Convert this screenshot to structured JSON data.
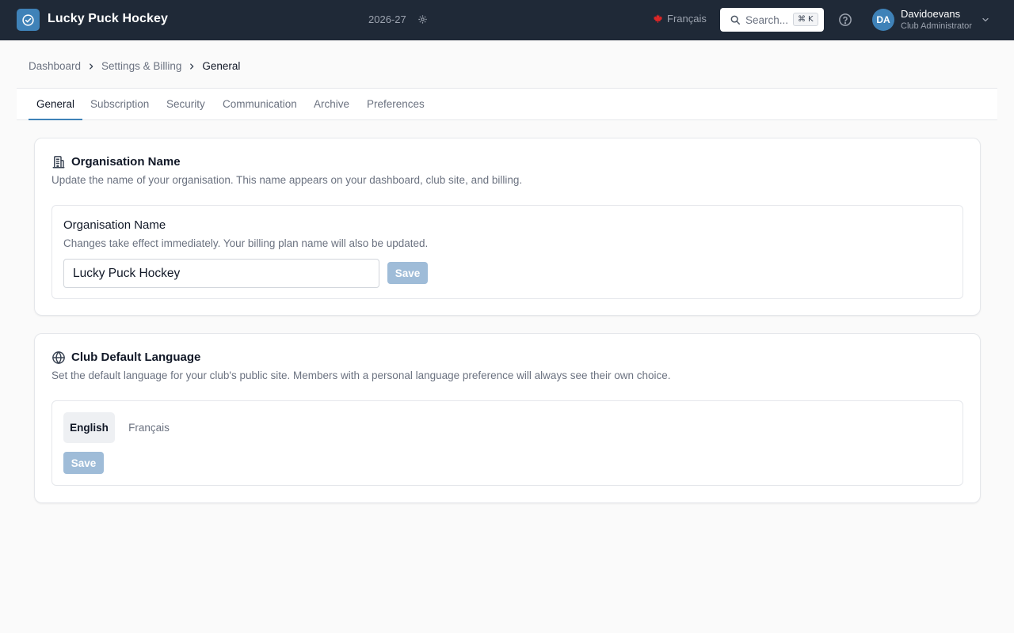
{
  "header": {
    "app_title": "Lucky Puck Hockey",
    "season": "2026-27",
    "language_link": "Français",
    "search_placeholder": "Search...",
    "search_shortcut_key": "K",
    "user": {
      "initials": "DA",
      "name": "Davidoevans",
      "role": "Club Administrator"
    }
  },
  "breadcrumb": {
    "items": [
      "Dashboard",
      "Settings & Billing"
    ],
    "current": "General"
  },
  "tabs": [
    "General",
    "Subscription",
    "Security",
    "Communication",
    "Archive",
    "Preferences"
  ],
  "active_tab": "General",
  "org_card": {
    "title": "Organisation Name",
    "description": "Update the name of your organisation. This name appears on your dashboard, club site, and billing.",
    "field_title": "Organisation Name",
    "field_description": "Changes take effect immediately. Your billing plan name will also be updated.",
    "input_value": "Lucky Puck Hockey",
    "save_label": "Save"
  },
  "language_card": {
    "title": "Club Default Language",
    "description": "Set the default language for your club's public site. Members with a personal language preference will always see their own choice.",
    "options": [
      "English",
      "Français"
    ],
    "selected": "English",
    "save_label": "Save"
  },
  "colors": {
    "header_bg": "#1f2937",
    "accent": "#3f82b8",
    "disabled_button": "#9fbcd8",
    "canada_flag": "#dc2626"
  }
}
